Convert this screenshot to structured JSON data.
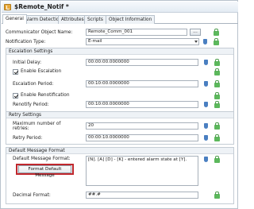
{
  "window": {
    "title": "$Remote_Notif *"
  },
  "tabs": [
    {
      "label": "General",
      "active": true
    },
    {
      "label": "Alarm Detection"
    },
    {
      "label": "Attributes"
    },
    {
      "label": "Scripts"
    },
    {
      "label": "Object Information"
    }
  ],
  "general": {
    "comm_object_label": "Communicator Object Name:",
    "comm_object_value": "Remote_Comm_001",
    "comm_object_browse": "...",
    "notification_type_label": "Notification Type:",
    "notification_type_value": "E-mail"
  },
  "escalation": {
    "title": "Escalation Settings",
    "initial_delay_label": "Initial Delay:",
    "initial_delay_value": "00:00:00.0000000",
    "enable_escalation_label": "Enable Escalation",
    "enable_escalation_checked": true,
    "escalation_period_label": "Escalation Period:",
    "escalation_period_value": "00:10:00.0000000",
    "enable_renotification_label": "Enable Renotification",
    "enable_renotification_checked": true,
    "renotify_period_label": "Renotify Period:",
    "renotify_period_value": "00:10:00.0000000"
  },
  "retry": {
    "title": "Retry Settings",
    "max_retries_label_line1": "Maximum number of",
    "max_retries_label_line2": "retries:",
    "max_retries_value": "20",
    "retry_period_label": "Retry Period:",
    "retry_period_value": "00:00:10.0000000"
  },
  "message_format": {
    "title": "Default Message Format",
    "format_label": "Default Message Format:",
    "format_value": "[N]. [A] [D] - [K] - entered alarm state at [Y].",
    "format_button": "Format Default Message",
    "decimal_label": "Decimal Format:",
    "decimal_value": "##.#"
  },
  "icons": {
    "title": "object-icon",
    "shield": "shield-icon",
    "lock": "lock-icon"
  },
  "colors": {
    "highlight_border": "#c0272d",
    "shield": "#4a7fc1",
    "lock": "#5cb85c"
  }
}
